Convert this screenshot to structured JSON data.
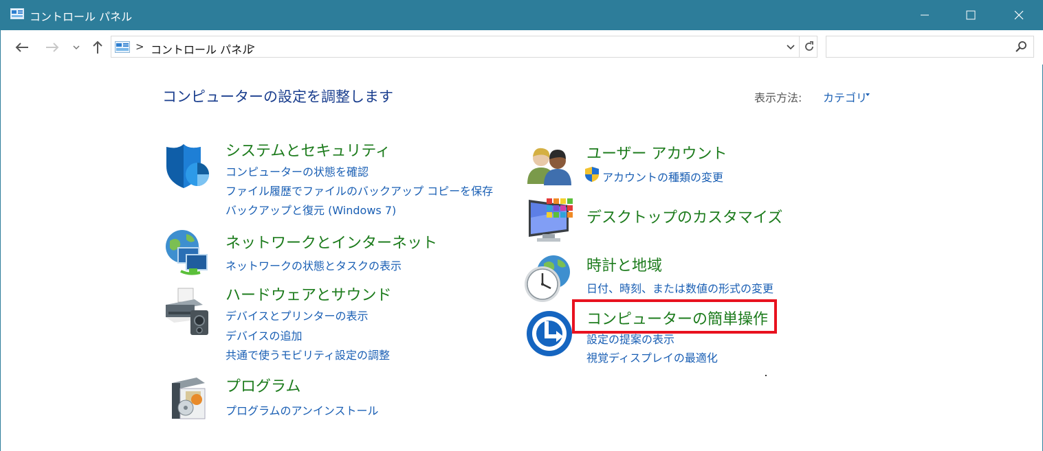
{
  "window": {
    "title": "コントロール パネル",
    "minimize_icon": "minimize-icon",
    "maximize_icon": "maximize-icon",
    "close_icon": "close-icon"
  },
  "navbar": {
    "breadcrumb": "コントロール パネル",
    "separator": ">",
    "search_placeholder": "",
    "search_value": ""
  },
  "main": {
    "heading": "コンピューターの設定を調整します",
    "view_label": "表示方法:",
    "view_value": "カテゴリ"
  },
  "categories_left": [
    {
      "title": "システムとセキュリティ",
      "icon": "shield-icon",
      "links": [
        "コンピューターの状態を確認",
        "ファイル履歴でファイルのバックアップ コピーを保存",
        "バックアップと復元 (Windows 7)"
      ]
    },
    {
      "title": "ネットワークとインターネット",
      "icon": "network-icon",
      "links": [
        "ネットワークの状態とタスクの表示"
      ]
    },
    {
      "title": "ハードウェアとサウンド",
      "icon": "printer-icon",
      "links": [
        "デバイスとプリンターの表示",
        "デバイスの追加",
        "共通で使うモビリティ設定の調整"
      ]
    },
    {
      "title": "プログラム",
      "icon": "programs-icon",
      "links": [
        "プログラムのアンインストール"
      ]
    }
  ],
  "categories_right": [
    {
      "title": "ユーザー アカウント",
      "icon": "users-icon",
      "links": [
        "アカウントの種類の変更"
      ]
    },
    {
      "title": "デスクトップのカスタマイズ",
      "icon": "desktop-icon",
      "links": []
    },
    {
      "title": "時計と地域",
      "icon": "clock-globe-icon",
      "links": [
        "日付、時刻、または数値の形式の変更"
      ]
    },
    {
      "title": "コンピューターの簡単操作",
      "icon": "ease-of-access-icon",
      "links": [
        "設定の提案の表示",
        "視覚ディスプレイの最適化"
      ]
    }
  ],
  "colors": {
    "titlebar": "#2d7d9a",
    "category_title": "#1c7b1c",
    "link": "#1a5fb4",
    "heading": "#1a3e8e",
    "highlight": "#e8121f"
  }
}
